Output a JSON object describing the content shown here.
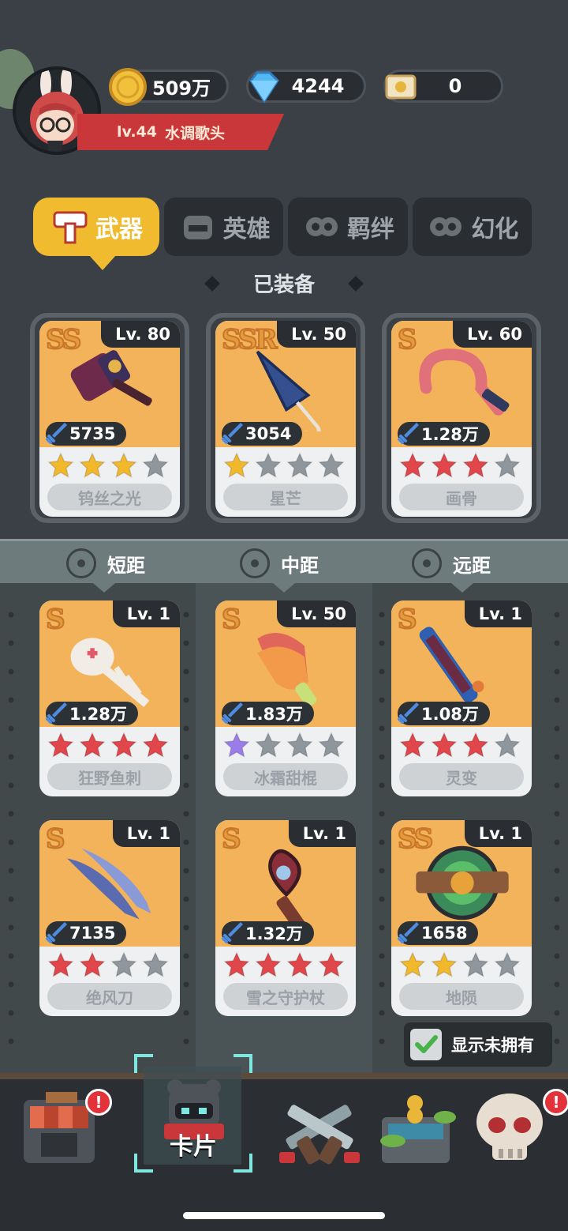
{
  "player": {
    "level": "lv.44",
    "name": "水调歌头"
  },
  "resources": [
    {
      "icon": "coin-icon",
      "value": "509万"
    },
    {
      "icon": "diamond-icon",
      "value": "4244"
    },
    {
      "icon": "scroll-icon",
      "value": "0"
    }
  ],
  "tabs": [
    {
      "label": "武器",
      "icon": "weapon-tab-icon",
      "active": true
    },
    {
      "label": "英雄",
      "icon": "hero-tab-icon",
      "active": false
    },
    {
      "label": "羁绊",
      "icon": "bond-tab-icon",
      "active": false
    },
    {
      "label": "幻化",
      "icon": "transform-tab-icon",
      "active": false
    }
  ],
  "equipped_title": "已装备",
  "equipped": [
    {
      "rank": "SS",
      "level": "Lv. 80",
      "power": "5735",
      "stars": [
        "gold",
        "gold",
        "gold",
        "gray"
      ],
      "name": "钨丝之光",
      "art_color": "#f3b35a",
      "weapon": "hammer"
    },
    {
      "rank": "SSR",
      "level": "Lv. 50",
      "power": "3054",
      "stars": [
        "gold",
        "gray",
        "gray",
        "gray"
      ],
      "name": "星芒",
      "art_color": "#f3b35a",
      "weapon": "umbrella"
    },
    {
      "rank": "S",
      "level": "Lv. 60",
      "power": "1.28万",
      "stars": [
        "red",
        "red",
        "red",
        "gray"
      ],
      "name": "画骨",
      "art_color": "#f3b35a",
      "weapon": "whip"
    }
  ],
  "ranges": [
    {
      "label": "短距"
    },
    {
      "label": "中距"
    },
    {
      "label": "远距"
    }
  ],
  "inventory": [
    {
      "rank": "S",
      "level": "Lv. 1",
      "power": "1.28万",
      "stars": [
        "red",
        "red",
        "red",
        "red"
      ],
      "name": "狂野鱼刺",
      "weapon": "fishbone"
    },
    {
      "rank": "S",
      "level": "Lv. 50",
      "power": "1.83万",
      "stars": [
        "purple",
        "gray",
        "gray",
        "gray"
      ],
      "name": "冰霜甜棍",
      "weapon": "popsicle"
    },
    {
      "rank": "S",
      "level": "Lv. 1",
      "power": "1.08万",
      "stars": [
        "red",
        "red",
        "red",
        "gray"
      ],
      "name": "灵变",
      "weapon": "blade"
    },
    {
      "rank": "S",
      "level": "Lv. 1",
      "power": "7135",
      "stars": [
        "red",
        "red",
        "gray",
        "gray"
      ],
      "name": "绝风刀",
      "weapon": "daggers"
    },
    {
      "rank": "S",
      "level": "Lv. 1",
      "power": "1.32万",
      "stars": [
        "red",
        "red",
        "red",
        "red"
      ],
      "name": "雪之守护杖",
      "weapon": "staff"
    },
    {
      "rank": "SS",
      "level": "Lv. 1",
      "power": "1658",
      "stars": [
        "gold",
        "gold",
        "gray",
        "gray"
      ],
      "name": "地陨",
      "weapon": "boom"
    }
  ],
  "show_unowned_label": "显示未拥有",
  "show_unowned_checked": true,
  "nav": [
    {
      "name": "shop",
      "badge": "!"
    },
    {
      "name": "cards",
      "label": "卡片",
      "selected": true
    },
    {
      "name": "battle"
    },
    {
      "name": "treasure"
    },
    {
      "name": "skull",
      "badge": "!"
    }
  ],
  "colors": {
    "gold_star": "#f2b82c",
    "red_star": "#e0464a",
    "gray_star": "#8f969c",
    "purple_star": "#9a7de8",
    "tab_active": "#f0bb2e"
  }
}
